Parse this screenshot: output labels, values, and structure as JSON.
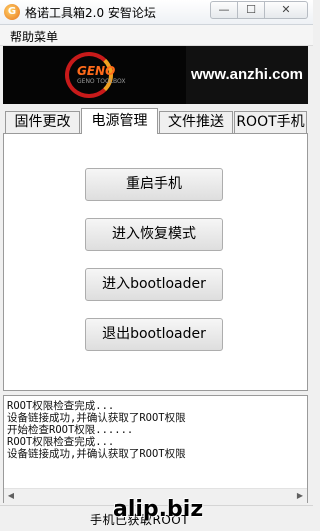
{
  "window": {
    "title": "格诺工具箱2.0 安智论坛",
    "icon_name": "gearbox-app-icon",
    "controls": {
      "minimize": "—",
      "maximize": "☐",
      "close": "✕"
    }
  },
  "menu": {
    "help_label": "帮助菜单"
  },
  "banner": {
    "logo_text": "GENO",
    "logo_sub": "GENO TOOLBOX",
    "url_text": "www.anzhi.com",
    "accent_colors": [
      "#c81a1a",
      "#f0a020",
      "#ff6a1a"
    ]
  },
  "tabs": [
    {
      "label": "固件更改"
    },
    {
      "label": "电源管理",
      "active": true
    },
    {
      "label": "文件推送"
    },
    {
      "label": "ROOT手机"
    }
  ],
  "actions": [
    {
      "label": "重启手机"
    },
    {
      "label": "进入恢复模式"
    },
    {
      "label": "进入bootloader"
    },
    {
      "label": "退出bootloader"
    }
  ],
  "log": {
    "lines": [
      "ROOT权限检查完成...",
      "设备链接成功,并确认获取了ROOT权限",
      "开始检查ROOT权限......",
      "ROOT权限检查完成...",
      "设备链接成功,并确认获取了ROOT权限"
    ]
  },
  "status": {
    "text": "手机已获取ROOT",
    "watermark": "alip.biz"
  }
}
